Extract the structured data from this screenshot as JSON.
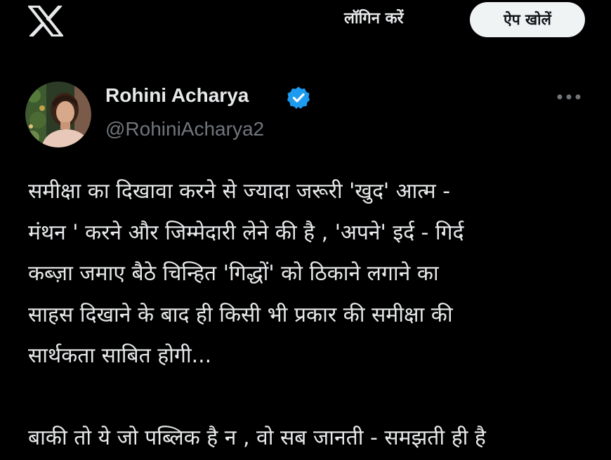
{
  "header": {
    "logo_icon": "x-logo-icon",
    "login_label": "लॉगिन करें",
    "open_app_label": "ऐप खोलें"
  },
  "tweet": {
    "author": {
      "name": "Rohini Acharya",
      "handle": "@RohiniAcharya2",
      "verified": true,
      "verified_color": "#1d9bf0"
    },
    "more_icon": "more-horizontal-icon",
    "text": "समीक्षा का दिखावा करने से ज्यादा जरूरी 'खुद' आत्म -\nमंथन ' करने और जिम्मेदारी लेने की है , 'अपने' इर्द - गिर्द\nकब्ज़ा जमाए बैठे चिन्हित 'गिद्धों' को ठिकाने लगाने का\nसाहस दिखाने के बाद ही किसी भी प्रकार की समीक्षा की\nसार्थकता साबित होगी...\n\nबाकी तो ये जो पब्लिक है न , वो सब जानती - समझती ही है"
  },
  "colors": {
    "background": "#000000",
    "text_primary": "#e7e9ea",
    "text_secondary": "#71767b",
    "button_bg": "#eff3f4",
    "accent": "#1d9bf0"
  }
}
